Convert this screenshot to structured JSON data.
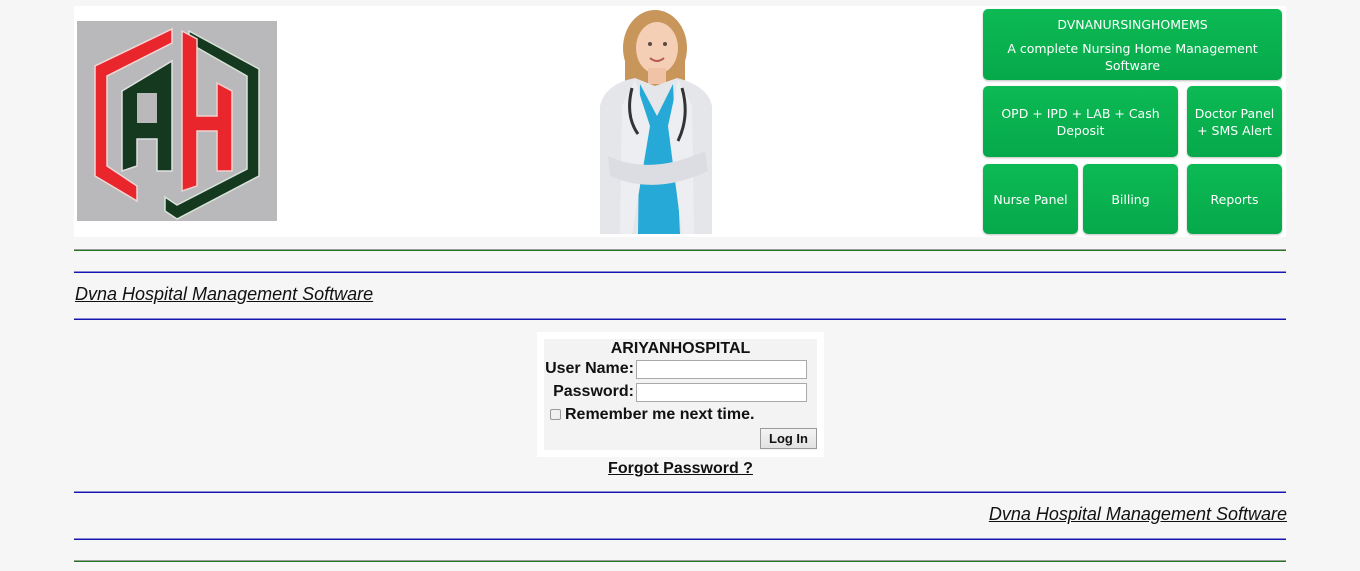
{
  "header": {
    "logo_alt": "AH logo",
    "doctor_image_alt": "Smiling nurse in lab coat with stethoscope",
    "tiles": {
      "product_name": "DVNANURSINGHOMEMS",
      "product_tagline": "A complete Nursing Home Management Software",
      "opd": "OPD + IPD +  LAB + Cash Deposit",
      "doctor": "Doctor Panel + SMS Alert",
      "nurse": "Nurse Panel",
      "billing": "Billing",
      "reports": "Reports"
    },
    "colors": {
      "tile_green": "#06a94a",
      "logo_red": "#e8262b",
      "logo_green": "#15391f"
    }
  },
  "top_link": "Dvna Hospital Management Software",
  "login": {
    "hospital_name": "ARIYANHOSPITAL",
    "username_label": "User Name:",
    "username_value": "",
    "password_label": "Password:",
    "password_value": "",
    "remember_label": "Remember me next time.",
    "remember_checked": false,
    "login_button": "Log In",
    "forgot_password": "Forgot Password ?"
  },
  "bottom_link": "Dvna Hospital Management Software"
}
